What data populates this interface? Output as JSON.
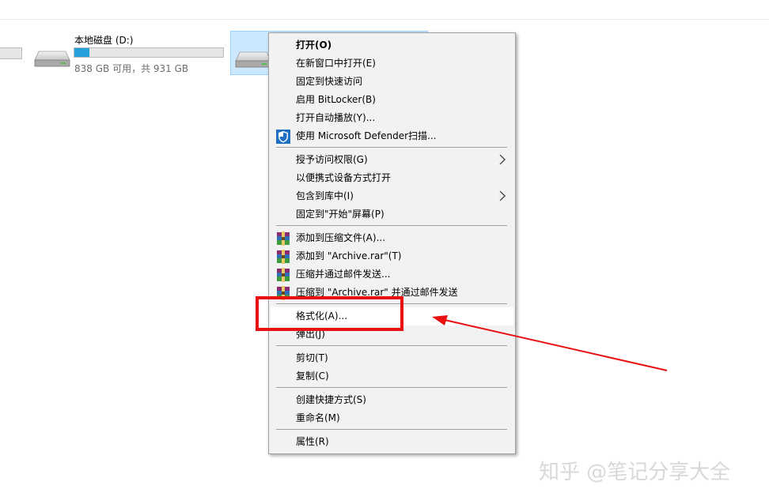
{
  "drive_c": {
    "bar_fill_fraction": 0.0
  },
  "drive_d": {
    "name": "本地磁盘 (D:)",
    "free_text": "838 GB 可用，共 931 GB",
    "used_fraction": 0.1,
    "bar_color": "#26a0da",
    "icon": "hard-drive-icon"
  },
  "drive_selected": {
    "icon": "hard-drive-icon"
  },
  "menu": {
    "items": [
      {
        "label": "打开(O)",
        "bold": true
      },
      {
        "label": "在新窗口中打开(E)"
      },
      {
        "label": "固定到快速访问"
      },
      {
        "label": "启用 BitLocker(B)"
      },
      {
        "label": "打开自动播放(Y)..."
      },
      {
        "label": "使用 Microsoft Defender扫描...",
        "icon": "defender-shield-icon"
      },
      {
        "label": "授予访问权限(G)",
        "submenu": true
      },
      {
        "label": "以便携式设备方式打开"
      },
      {
        "label": "包含到库中(I)",
        "submenu": true
      },
      {
        "label": "固定到\"开始\"屏幕(P)"
      },
      {
        "label": "添加到压缩文件(A)...",
        "icon": "winrar-icon"
      },
      {
        "label": "添加到 \"Archive.rar\"(T)",
        "icon": "winrar-icon"
      },
      {
        "label": "压缩并通过邮件发送...",
        "icon": "winrar-icon"
      },
      {
        "label": "压缩到 \"Archive.rar\" 并通过邮件发送",
        "icon": "winrar-icon"
      },
      {
        "label": "格式化(A)...",
        "highlighted": true
      },
      {
        "label": "弹出(J)"
      },
      {
        "label": "剪切(T)"
      },
      {
        "label": "复制(C)"
      },
      {
        "label": "创建快捷方式(S)"
      },
      {
        "label": "重命名(M)"
      },
      {
        "label": "属性(R)"
      }
    ]
  },
  "annotation": {
    "box_color": "#e81010",
    "arrow_color": "#e81010"
  },
  "watermark": {
    "text": "知乎 @笔记分享大全"
  },
  "icons": {
    "submenu_arrow": "chevron-right-icon",
    "defender": "defender-shield-icon",
    "winrar": "winrar-icon"
  }
}
